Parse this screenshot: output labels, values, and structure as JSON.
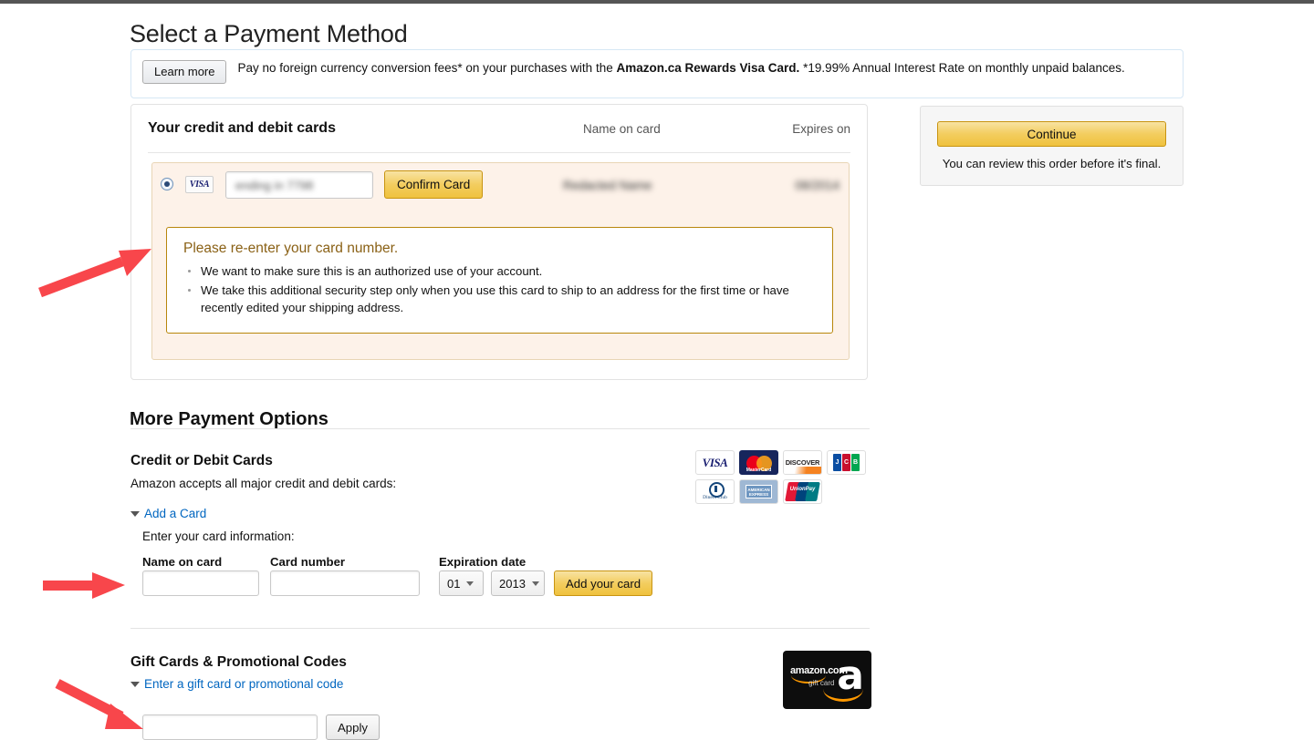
{
  "page_title": "Select a Payment Method",
  "promo": {
    "learn_more_label": "Learn more",
    "text_before": "Pay no foreign currency conversion fees* on your purchases with the ",
    "card_name": "Amazon.ca Rewards Visa Card.",
    "text_after": " *19.99% Annual Interest Rate on monthly unpaid balances."
  },
  "saved_cards": {
    "section_title": "Your credit and debit cards",
    "col_name_on_card": "Name on card",
    "col_expires_on": "Expires on",
    "row": {
      "card_brand": "VISA",
      "card_number_value": "ending in 7798",
      "confirm_button": "Confirm Card",
      "name_on_card": "Redacted Name",
      "expires_on": "08/2014",
      "selected": true
    },
    "warning": {
      "title": "Please re-enter your card number.",
      "bullets": [
        "We want to make sure this is an authorized use of your account.",
        "We take this additional security step only when you use this card to ship to an address for the first time or have recently edited your shipping address."
      ]
    }
  },
  "continue_panel": {
    "button_label": "Continue",
    "note": "You can review this order before it's final."
  },
  "more_options": {
    "heading": "More Payment Options",
    "credit_section": {
      "title": "Credit or Debit Cards",
      "subtitle": "Amazon accepts all major credit and debit cards:",
      "disclosure_label": "Add a Card",
      "form_note": "Enter your card information:",
      "name_label": "Name on card",
      "name_value": "",
      "number_label": "Card number",
      "number_value": "",
      "expiration_label": "Expiration date",
      "month_value": "01",
      "year_value": "2013",
      "add_button": "Add your card",
      "accepted_logos": [
        "visa-logo",
        "mastercard-logo",
        "discover-logo",
        "jcb-logo",
        "diners-club-logo",
        "american-express-logo",
        "unionpay-logo"
      ],
      "logo_text": {
        "visa": "VISA",
        "mastercard": "MasterCard",
        "discover": "DISCOVER",
        "jcb_letters": [
          "J",
          "C",
          "B"
        ],
        "diners": "Diners Club",
        "amex": "AMERICAN EXPRESS",
        "unionpay": "UnionPay"
      }
    },
    "gift_section": {
      "title": "Gift Cards & Promotional Codes",
      "disclosure_label": "Enter a gift card or promotional code",
      "code_value": "",
      "apply_button": "Apply",
      "logo_name": "amazon-gift-card-logo",
      "logo_text": {
        "brand": "amazon.com",
        "sub": "gift card",
        "mark": "a"
      }
    }
  },
  "annotations": {
    "arrow_color": "#f8464b",
    "arrows": [
      "arrow-to-warning-box",
      "arrow-to-name-on-card-field",
      "arrow-to-gift-code-field"
    ]
  }
}
